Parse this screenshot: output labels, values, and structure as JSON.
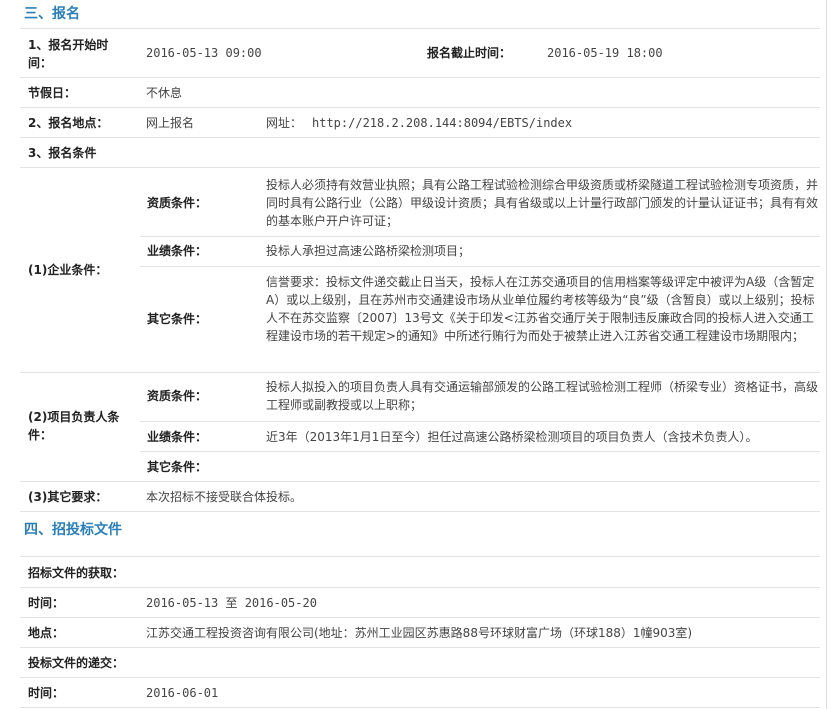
{
  "section3": {
    "title": "三、报名",
    "start_label_line1": "1、报名开始时",
    "start_label_line2": "间：",
    "start_time": "2016-05-13 09:00",
    "end_label": "报名截止时间：",
    "end_time": "2016-05-19 18:00",
    "holiday_label": "节假日：",
    "holiday_value": "不休息",
    "location_label": "2、报名地点：",
    "location_value": "网上报名",
    "url_label": "网址：",
    "url_value": "http://218.2.208.144:8094/EBTS/index",
    "conditions_label": "3、报名条件",
    "enterprise": {
      "label": "(1)企业条件：",
      "qualification_label": "资质条件：",
      "qualification_text": "投标人必须持有效营业执照；具有公路工程试验检测综合甲级资质或桥梁隧道工程试验检测专项资质，并同时具有公路行业（公路）甲级设计资质；具有省级或以上计量行政部门颁发的计量认证证书；具有有效的基本账户开户许可证；",
      "performance_label": "业绩条件：",
      "performance_text": "投标人承担过高速公路桥梁检测项目；",
      "other_label": "其它条件：",
      "other_text": "信誉要求：投标文件递交截止日当天，投标人在江苏交通项目的信用档案等级评定中被评为A级（含暂定A）或以上级别，且在苏州市交通建设市场从业单位履约考核等级为“良”级（含暂良）或以上级别；投标人不在苏交监察〔2007〕13号文《关于印发<江苏省交通厅关于限制违反廉政合同的投标人进入交通工程建设市场的若干规定>的通知》中所述行贿行为而处于被禁止进入江苏省交通工程建设市场期限内；"
    },
    "manager": {
      "label_line1": "(2)项目负责人条",
      "label_line2": "件：",
      "qualification_label": "资质条件：",
      "qualification_text": "投标人拟投入的项目负责人具有交通运输部颁发的公路工程试验检测工程师（桥梁专业）资格证书，高级工程师或副教授或以上职称；",
      "performance_label": "业绩条件：",
      "performance_text": "近3年（2013年1月1日至今）担任过高速公路桥梁检测项目的项目负责人（含技术负责人）。",
      "other_label": "其它条件："
    },
    "other_req_label": "(3)其它要求：",
    "other_req_value": "本次招标不接受联合体投标。"
  },
  "section4": {
    "title": "四、招投标文件",
    "obtain_label": "招标文件的获取：",
    "time_label": "时间：",
    "time_value": "2016-05-13 至 2016-05-20",
    "place_label": "地点：",
    "place_value": "江苏交通工程投资咨询有限公司(地址：苏州工业园区苏惠路88号环球财富广场（环球188）1幢903室)",
    "submit_label": "投标文件的递交：",
    "submit_time_label": "时间：",
    "submit_time_value": "2016-06-01"
  }
}
